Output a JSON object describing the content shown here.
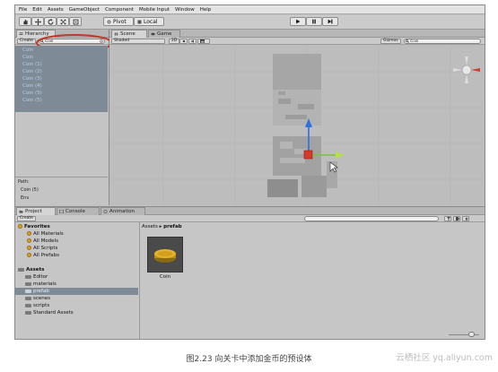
{
  "menu": [
    "File",
    "Edit",
    "Assets",
    "GameObject",
    "Component",
    "Mobile Input",
    "Window",
    "Help"
  ],
  "toolbar": {
    "pivot_label": "Pivot",
    "local_label": "Local"
  },
  "hierarchy": {
    "tab_label": "Hierarchy",
    "create_label": "Create",
    "search_value": "Coin",
    "items": [
      "Coin",
      "Coin",
      "Coin (1)",
      "Coin (2)",
      "Coin (3)",
      "Coin (4)",
      "Coin (5)",
      "Coin (5)"
    ],
    "path_label": "Path:",
    "path_items": [
      "Coin (5)",
      "Env"
    ]
  },
  "scene": {
    "tab_scene": "Scene",
    "tab_game": "Game",
    "shading_value": "Shaded",
    "mode_2d": "2D",
    "gizmos_label": "Gizmos",
    "search_value": "Coin"
  },
  "project": {
    "tab_project": "Project",
    "tab_console": "Console",
    "tab_animation": "Animation",
    "create_label": "Create",
    "favorites_label": "Favorites",
    "favorites": [
      "All Materials",
      "All Models",
      "All Scripts",
      "All Prefabs"
    ],
    "assets_label": "Assets",
    "folders": [
      "Editor",
      "materials",
      "prefab",
      "scenes",
      "scripts",
      "Standard Assets"
    ],
    "breadcrumb_root": "Assets",
    "breadcrumb_sep": "▸",
    "breadcrumb_current": "prefab",
    "asset_name": "Coin"
  },
  "caption": "图2.23    向关卡中添加金币的预设体",
  "watermark": "云栖社区 yq.aliyun.com",
  "colors": {
    "selection": "#7e8a96",
    "highlight_circle": "#c0392b",
    "coin": "#d9a21c"
  }
}
